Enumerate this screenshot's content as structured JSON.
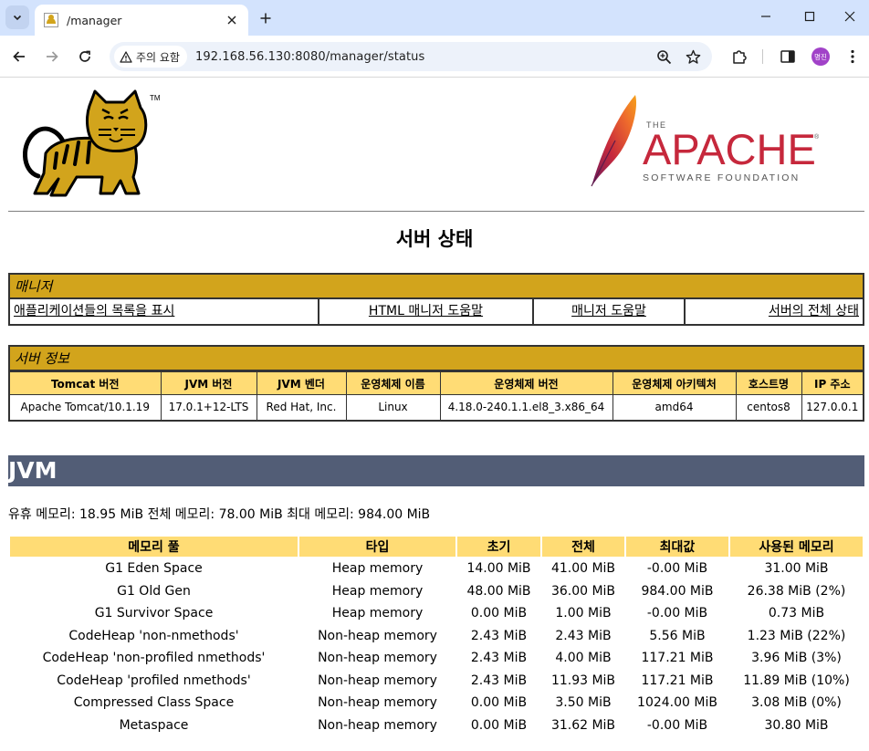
{
  "browser": {
    "tab_title": "/manager",
    "security_chip": "주의 요함",
    "url": "192.168.56.130:8080/manager/status",
    "profile_initials": "명진"
  },
  "page": {
    "title": "서버 상태",
    "tomcat_tm": "TM",
    "apache": {
      "the": "THE",
      "name": "APACHE",
      "foundation": "SOFTWARE FOUNDATION",
      "reg": "®"
    }
  },
  "manager": {
    "heading": "매니저",
    "links": [
      "애플리케이션들의 목록을 표시",
      "HTML 매니저 도움말",
      "매니저 도움말",
      "서버의 전체 상태"
    ]
  },
  "server_info": {
    "heading": "서버 정보",
    "columns": [
      "Tomcat 버전",
      "JVM 버전",
      "JVM 벤더",
      "운영체제 이름",
      "운영체제 버전",
      "운영체제 아키텍처",
      "호스트명",
      "IP 주소"
    ],
    "values": [
      "Apache Tomcat/10.1.19",
      "17.0.1+12-LTS",
      "Red Hat, Inc.",
      "Linux",
      "4.18.0-240.1.1.el8_3.x86_64",
      "amd64",
      "centos8",
      "127.0.0.1"
    ]
  },
  "jvm": {
    "heading": "JVM",
    "summary": "유휴 메모리: 18.95 MiB 전체 메모리: 78.00 MiB 최대 메모리: 984.00 MiB",
    "columns": [
      "메모리 풀",
      "타입",
      "초기",
      "전체",
      "최대값",
      "사용된 메모리"
    ],
    "rows": [
      [
        "G1 Eden Space",
        "Heap memory",
        "14.00 MiB",
        "41.00 MiB",
        "-0.00 MiB",
        "31.00 MiB"
      ],
      [
        "G1 Old Gen",
        "Heap memory",
        "48.00 MiB",
        "36.00 MiB",
        "984.00 MiB",
        "26.38 MiB (2%)"
      ],
      [
        "G1 Survivor Space",
        "Heap memory",
        "0.00 MiB",
        "1.00 MiB",
        "-0.00 MiB",
        "0.73 MiB"
      ],
      [
        "CodeHeap 'non-nmethods'",
        "Non-heap memory",
        "2.43 MiB",
        "2.43 MiB",
        "5.56 MiB",
        "1.23 MiB (22%)"
      ],
      [
        "CodeHeap 'non-profiled nmethods'",
        "Non-heap memory",
        "2.43 MiB",
        "4.00 MiB",
        "117.21 MiB",
        "3.96 MiB (3%)"
      ],
      [
        "CodeHeap 'profiled nmethods'",
        "Non-heap memory",
        "2.43 MiB",
        "11.93 MiB",
        "117.21 MiB",
        "11.89 MiB (10%)"
      ],
      [
        "Compressed Class Space",
        "Non-heap memory",
        "0.00 MiB",
        "3.50 MiB",
        "1024.00 MiB",
        "3.08 MiB (0%)"
      ],
      [
        "Metaspace",
        "Non-heap memory",
        "0.00 MiB",
        "31.62 MiB",
        "-0.00 MiB",
        "30.80 MiB"
      ]
    ]
  },
  "colors": {
    "panel_title_bg": "#d2a41c",
    "table_header_bg": "#ffdc75",
    "jvm_header_bg": "#525d76",
    "apache_red": "#c6283c"
  }
}
